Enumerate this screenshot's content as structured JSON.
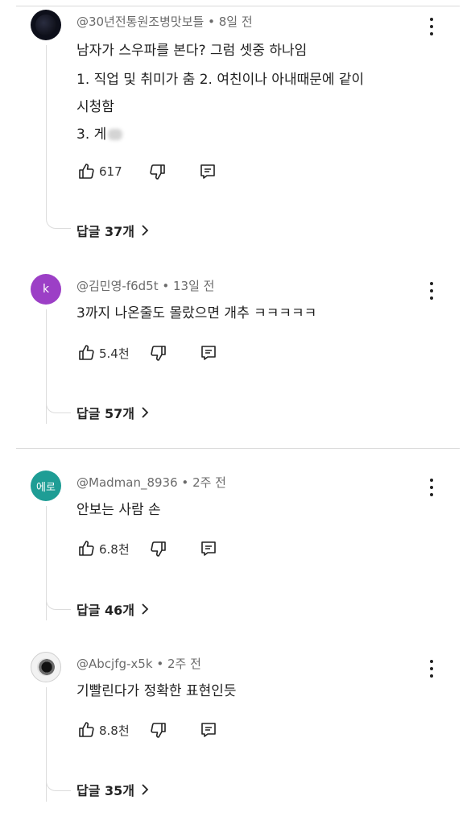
{
  "comments": [
    {
      "handle": "@30년전통원조병맛보틀",
      "time": "8일 전",
      "avatar_letter": "",
      "avatar_color": "#0d0f1a",
      "lines": [
        "남자가 스우파를 본다? 그럼 셋중 하나임",
        "1. 직업 및 취미가 춤  2. 여친이나 아내때문에 같이",
        "시청함",
        "3. 게"
      ],
      "likes": "617",
      "replies_label": "답글 37개"
    },
    {
      "handle": "@김민영-f6d5t",
      "time": "13일 전",
      "avatar_letter": "k",
      "avatar_color": "#9c3fc6",
      "lines": [
        "3까지 나온줄도 몰랐으면 개추 ㅋㅋㅋㅋㅋ"
      ],
      "likes": "5.4천",
      "replies_label": "답글 57개"
    },
    {
      "handle": "@Madman_8936",
      "time": "2주 전",
      "avatar_letter": "에로",
      "avatar_color": "#1e9d95",
      "lines": [
        "안보는 사람 손"
      ],
      "likes": "6.8천",
      "replies_label": "답글 46개"
    },
    {
      "handle": "@Abcjfg-x5k",
      "time": "2주 전",
      "avatar_letter": "",
      "avatar_color": "#3a3a3a",
      "lines": [
        "기빨린다가 정확한 표현인듯"
      ],
      "likes": "8.8천",
      "replies_label": "답글 35개"
    }
  ],
  "separator": "•",
  "icons": {
    "like": "thumbs-up-icon",
    "dislike": "thumbs-down-icon",
    "reply": "reply-icon",
    "more": "more-vert-icon",
    "chevron": "chevron-right-icon"
  }
}
